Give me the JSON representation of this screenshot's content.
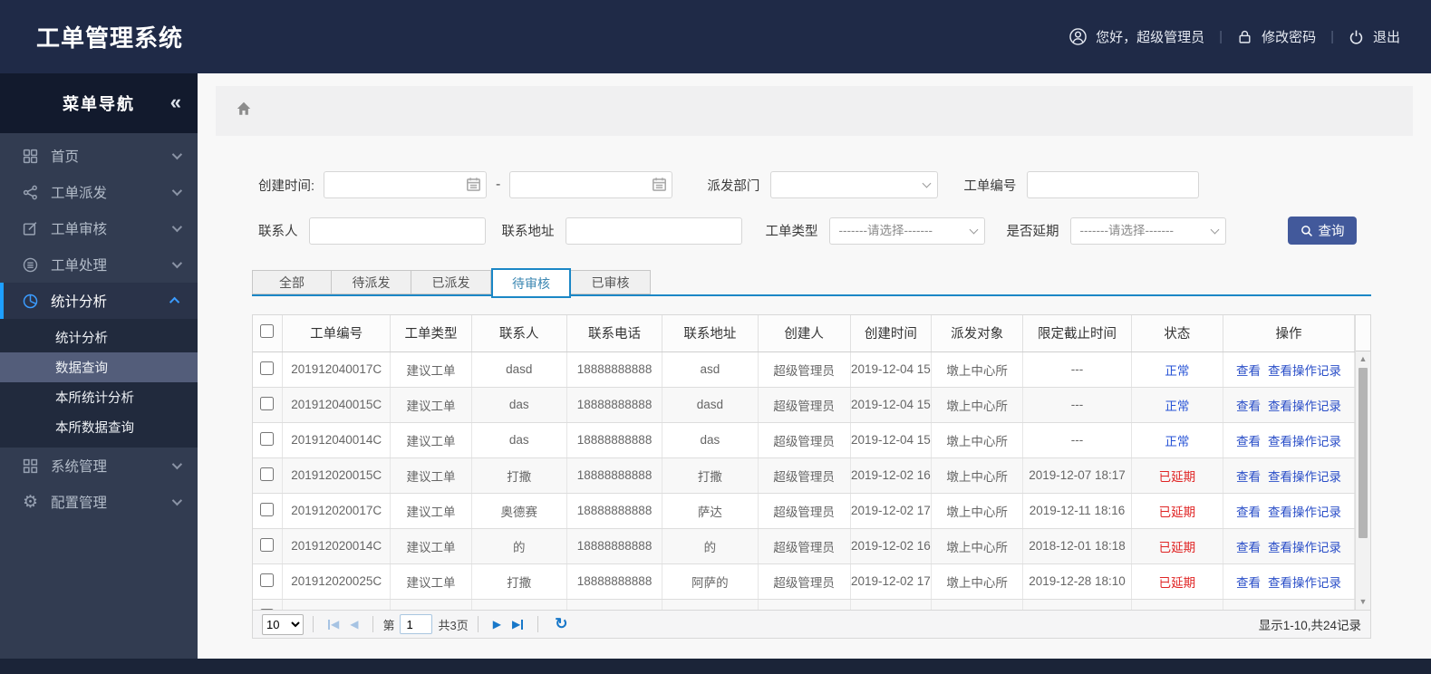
{
  "header": {
    "title": "工单管理系统",
    "greeting": "您好，超级管理员",
    "change_password": "修改密码",
    "logout": "退出",
    "separator": "|"
  },
  "sidebar": {
    "title": "菜单导航",
    "collapse_icon": "«",
    "items": [
      {
        "label": "首页",
        "icon": "home-grid-icon"
      },
      {
        "label": "工单派发",
        "icon": "share-icon"
      },
      {
        "label": "工单审核",
        "icon": "edit-icon"
      },
      {
        "label": "工单处理",
        "icon": "process-icon"
      },
      {
        "label": "统计分析",
        "icon": "pie-chart-icon",
        "active": true
      },
      {
        "label": "系统管理",
        "icon": "modules-icon"
      },
      {
        "label": "配置管理",
        "icon": "gear-icon"
      }
    ],
    "submenu": [
      {
        "label": "统计分析"
      },
      {
        "label": "数据查询",
        "selected": true
      },
      {
        "label": "本所统计分析"
      },
      {
        "label": "本所数据查询"
      }
    ]
  },
  "filters": {
    "create_time_label": "创建时间:",
    "range_separator": "-",
    "dispatch_dept_label": "派发部门",
    "order_no_label": "工单编号",
    "contact_label": "联系人",
    "address_label": "联系地址",
    "order_type_label": "工单类型",
    "delay_label": "是否延期",
    "select_placeholder": "-------请选择-------",
    "search_button": "查询"
  },
  "tabs": {
    "items": [
      "全部",
      "待派发",
      "已派发",
      "待审核",
      "已审核"
    ],
    "active_index": 3
  },
  "table": {
    "columns": [
      "工单编号",
      "工单类型",
      "联系人",
      "联系电话",
      "联系地址",
      "创建人",
      "创建时间",
      "派发对象",
      "限定截止时间",
      "状态",
      "操作"
    ],
    "op_view": "查看",
    "op_record": "查看操作记录",
    "rows": [
      {
        "order_no": "201912040017C",
        "type": "建议工单",
        "contact": "dasd",
        "phone": "18888888888",
        "address": "asd",
        "creator": "超级管理员",
        "created": "2019-12-04 15",
        "target": "墩上中心所",
        "deadline": "---",
        "status": "正常",
        "status_type": "normal",
        "has_ops": true
      },
      {
        "order_no": "201912040015C",
        "type": "建议工单",
        "contact": "das",
        "phone": "18888888888",
        "address": "dasd",
        "creator": "超级管理员",
        "created": "2019-12-04 15",
        "target": "墩上中心所",
        "deadline": "---",
        "status": "正常",
        "status_type": "normal",
        "has_ops": true
      },
      {
        "order_no": "201912040014C",
        "type": "建议工单",
        "contact": "das",
        "phone": "18888888888",
        "address": "das",
        "creator": "超级管理员",
        "created": "2019-12-04 15",
        "target": "墩上中心所",
        "deadline": "---",
        "status": "正常",
        "status_type": "normal",
        "has_ops": true
      },
      {
        "order_no": "201912020015C",
        "type": "建议工单",
        "contact": "打撒",
        "phone": "18888888888",
        "address": "打撒",
        "creator": "超级管理员",
        "created": "2019-12-02 16",
        "target": "墩上中心所",
        "deadline": "2019-12-07 18:17",
        "status": "已延期",
        "status_type": "delayed",
        "has_ops": true
      },
      {
        "order_no": "201912020017C",
        "type": "建议工单",
        "contact": "奥德赛",
        "phone": "18888888888",
        "address": "萨达",
        "creator": "超级管理员",
        "created": "2019-12-02 17",
        "target": "墩上中心所",
        "deadline": "2019-12-11 18:16",
        "status": "已延期",
        "status_type": "delayed",
        "has_ops": true
      },
      {
        "order_no": "201912020014C",
        "type": "建议工单",
        "contact": "的",
        "phone": "18888888888",
        "address": "的",
        "creator": "超级管理员",
        "created": "2019-12-02 16",
        "target": "墩上中心所",
        "deadline": "2018-12-01 18:18",
        "status": "已延期",
        "status_type": "delayed",
        "has_ops": true
      },
      {
        "order_no": "201912020025C",
        "type": "建议工单",
        "contact": "打撒",
        "phone": "18888888888",
        "address": "阿萨的",
        "creator": "超级管理员",
        "created": "2019-12-02 17",
        "target": "墩上中心所",
        "deadline": "2019-12-28 18:10",
        "status": "已延期",
        "status_type": "delayed",
        "has_ops": true
      },
      {
        "order_no": "",
        "type": "",
        "contact": "",
        "phone": "",
        "address": "",
        "creator": "",
        "created": "",
        "target": "",
        "deadline": "",
        "status": "",
        "status_type": "",
        "has_ops": false
      }
    ]
  },
  "pagination": {
    "page_size": "10",
    "page_prefix": "第",
    "current_page": "1",
    "total_pages": "共3页",
    "refresh_icon": "↻",
    "record_info": "显示1-10,共24记录"
  },
  "colors": {
    "header_bg": "#1f2a47",
    "sidebar_bg": "#323c51",
    "accent_blue": "#1e9fff",
    "tab_border_blue": "#1b87c6",
    "button_blue": "#42599b",
    "link_blue": "#2b4fc8",
    "status_normal_blue": "#2753d6",
    "status_delayed_red": "#e02525"
  }
}
